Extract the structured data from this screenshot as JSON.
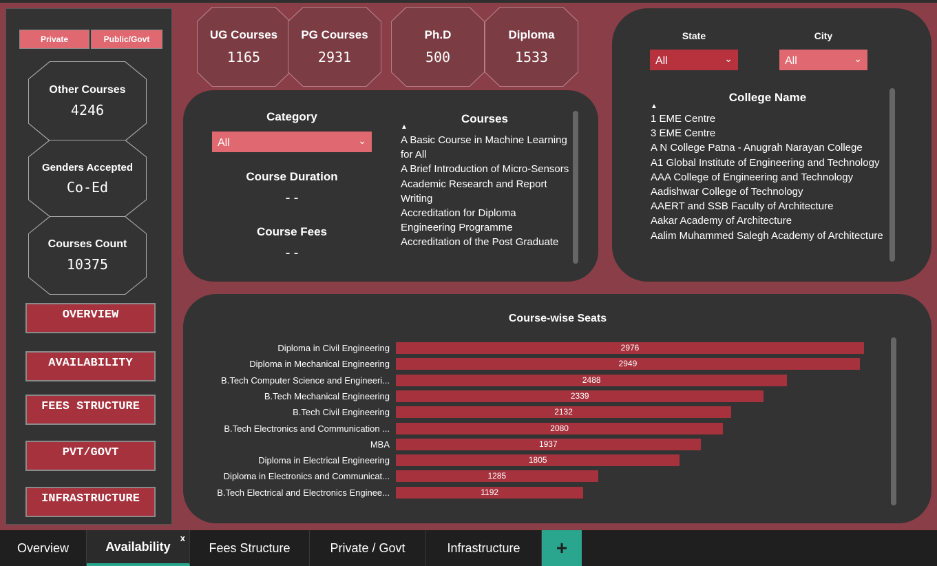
{
  "sidebar": {
    "toggles": [
      "Private",
      "Public/Govt"
    ],
    "cards": [
      {
        "label": "Other Courses",
        "value": "4246"
      },
      {
        "label": "Genders Accepted",
        "value": "Co-Ed"
      },
      {
        "label": "Courses Count",
        "value": "10375"
      }
    ],
    "nav": [
      "OVERVIEW",
      "AVAILABILITY",
      "FEES STRUCTURE",
      "PVT/GOVT",
      "INFRASTRUCTURE"
    ]
  },
  "kpis": [
    {
      "label": "UG Courses",
      "value": "1165"
    },
    {
      "label": "PG Courses",
      "value": "2931"
    },
    {
      "label": "Ph.D",
      "value": "500"
    },
    {
      "label": "Diploma",
      "value": "1533"
    }
  ],
  "filters": {
    "category_label": "Category",
    "category_value": "All",
    "duration_label": "Course Duration",
    "duration_value": "--",
    "fees_label": "Course Fees",
    "fees_value": "--",
    "courses_title": "Courses",
    "courses": [
      "A Basic Course in Machine Learning for All",
      "A Brief Introduction of Micro-Sensors",
      "Academic Research and Report Writing",
      "Accreditation for Diploma Engineering Programme",
      "Accreditation of the Post Graduate"
    ]
  },
  "location": {
    "state_label": "State",
    "state_value": "All",
    "city_label": "City",
    "city_value": "All",
    "college_title": "College Name",
    "colleges": [
      "1 EME Centre",
      "3 EME Centre",
      "A N College Patna - Anugrah Narayan College",
      "A1 Global Institute of Engineering and Technology",
      "AAA College of Engineering and Technology",
      "Aadishwar College of Technology",
      "AAERT and SSB Faculty of Architecture",
      "Aakar Academy of Architecture",
      "Aalim Muhammed Salegh Academy of Architecture"
    ]
  },
  "chart_data": {
    "type": "bar",
    "orientation": "horizontal",
    "title": "Course-wise Seats",
    "categories": [
      "Diploma in Civil Engineering",
      "Diploma in Mechanical Engineering",
      "B.Tech Computer Science and Engineeri...",
      "B.Tech Mechanical Engineering",
      "B.Tech Civil Engineering",
      "B.Tech Electronics and Communication ...",
      "MBA",
      "Diploma in Electrical Engineering",
      "Diploma in Electronics and Communicat...",
      "B.Tech Electrical and Electronics Enginee..."
    ],
    "values": [
      2976,
      2949,
      2488,
      2339,
      2132,
      2080,
      1937,
      1805,
      1285,
      1192
    ],
    "colors": {
      "bar": "#a6323d"
    }
  },
  "tabs": {
    "items": [
      "Overview",
      "Availability",
      "Fees Structure",
      "Private / Govt",
      "Infrastructure"
    ],
    "active": "Availability",
    "close_glyph": "x",
    "add_glyph": "+"
  },
  "colors": {
    "background": "#8a3e47",
    "panel": "#333333",
    "accent": "#e06870",
    "tab_accent": "#2aa58e"
  }
}
